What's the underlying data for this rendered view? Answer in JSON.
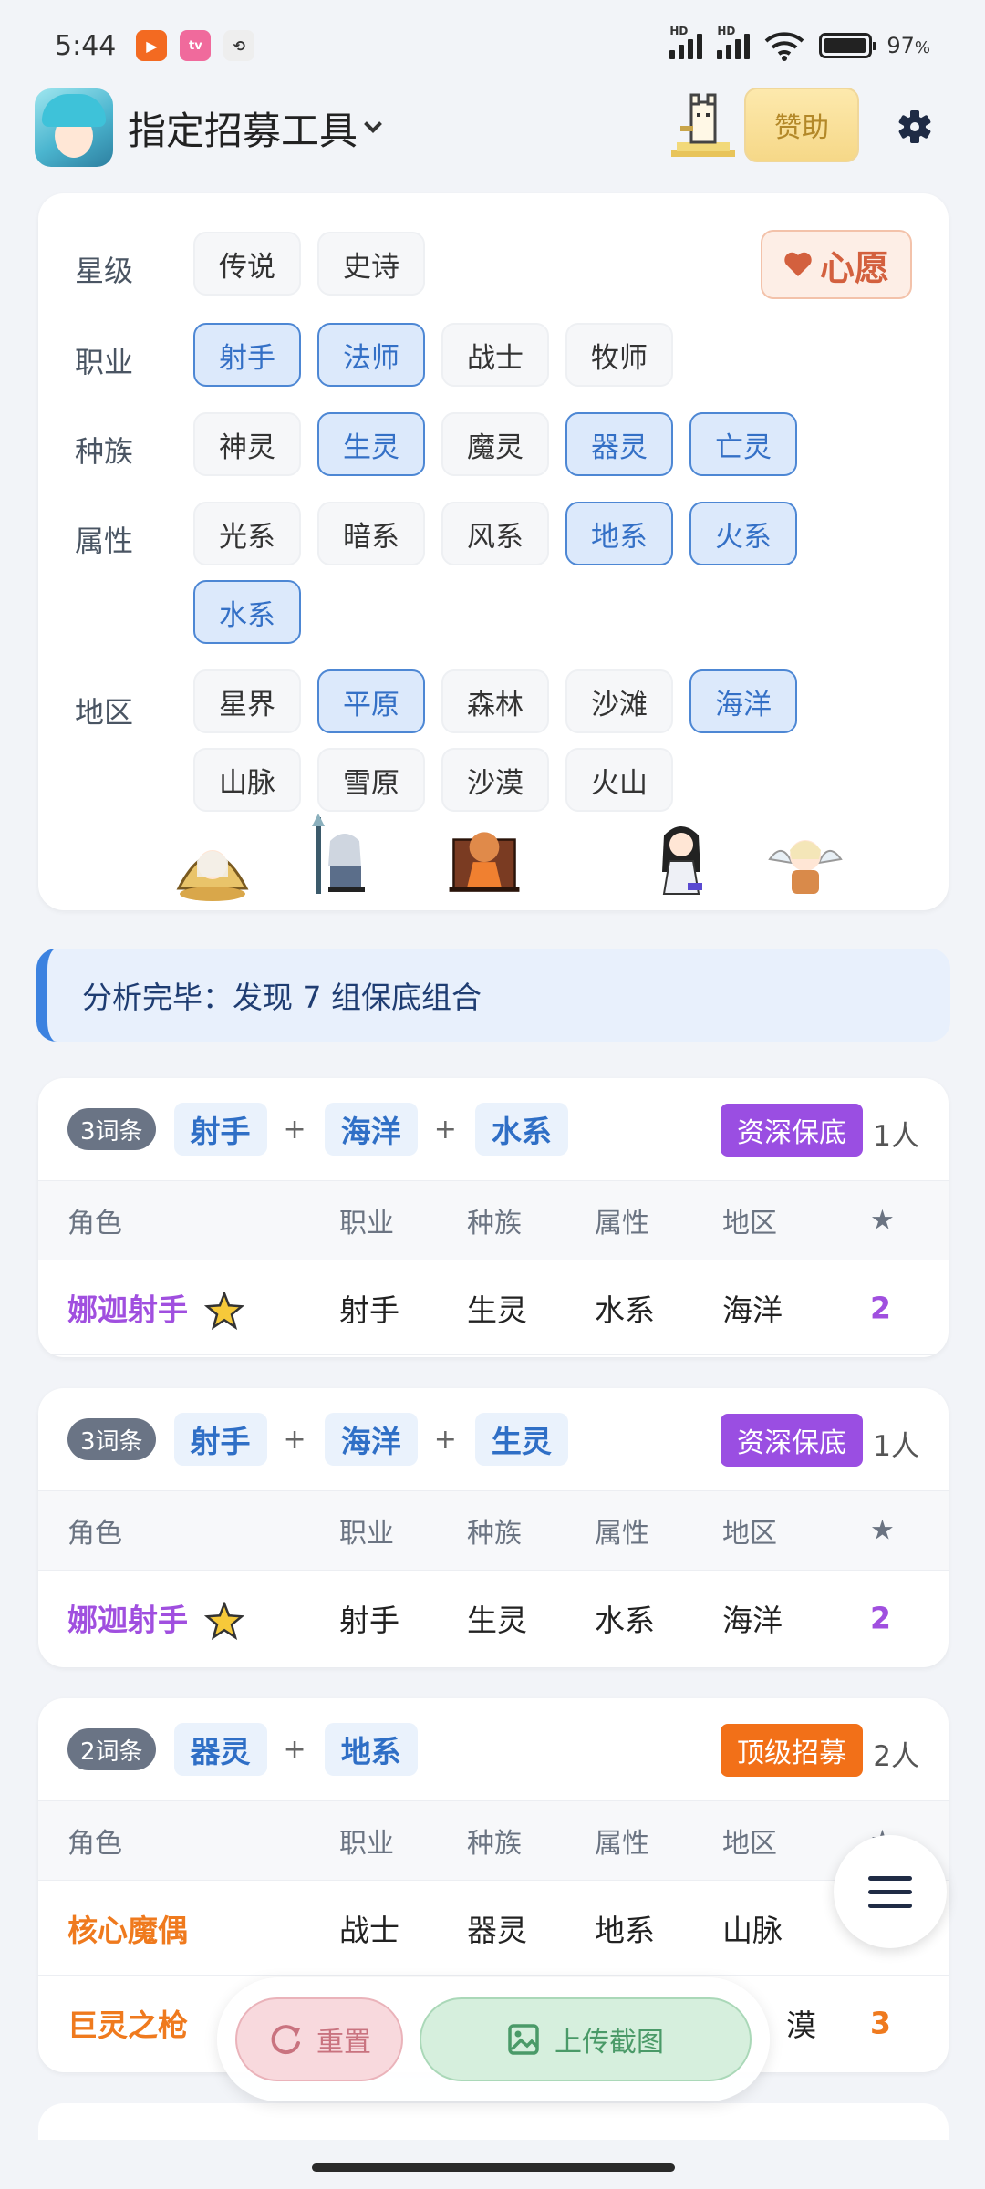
{
  "status_bar": {
    "time": "5:44",
    "battery": "97",
    "battery_level": 0.97,
    "notif_icons": [
      "camera-icon",
      "bilibili-icon",
      "sync-icon"
    ]
  },
  "app_bar": {
    "title": "指定招募工具",
    "sponsor_label": "赞助"
  },
  "filters": {
    "wish_label": "心愿",
    "groups": [
      {
        "label": "星级",
        "options": [
          {
            "text": "传说",
            "selected": false
          },
          {
            "text": "史诗",
            "selected": false
          }
        ]
      },
      {
        "label": "职业",
        "options": [
          {
            "text": "射手",
            "selected": true
          },
          {
            "text": "法师",
            "selected": true
          },
          {
            "text": "战士",
            "selected": false
          },
          {
            "text": "牧师",
            "selected": false
          }
        ]
      },
      {
        "label": "种族",
        "options": [
          {
            "text": "神灵",
            "selected": false
          },
          {
            "text": "生灵",
            "selected": true
          },
          {
            "text": "魔灵",
            "selected": false
          },
          {
            "text": "器灵",
            "selected": true
          },
          {
            "text": "亡灵",
            "selected": true
          }
        ]
      },
      {
        "label": "属性",
        "options": [
          {
            "text": "光系",
            "selected": false
          },
          {
            "text": "暗系",
            "selected": false
          },
          {
            "text": "风系",
            "selected": false
          },
          {
            "text": "地系",
            "selected": true
          },
          {
            "text": "火系",
            "selected": true
          },
          {
            "text": "水系",
            "selected": true
          }
        ]
      },
      {
        "label": "地区",
        "options": [
          {
            "text": "星界",
            "selected": false
          },
          {
            "text": "平原",
            "selected": true
          },
          {
            "text": "森林",
            "selected": false
          },
          {
            "text": "沙滩",
            "selected": false
          },
          {
            "text": "海洋",
            "selected": true
          },
          {
            "text": "山脉",
            "selected": false
          },
          {
            "text": "雪原",
            "selected": false
          },
          {
            "text": "沙漠",
            "selected": false
          },
          {
            "text": "火山",
            "selected": false
          }
        ]
      }
    ]
  },
  "analysis": {
    "text": "分析完毕：发现 7 组保底组合"
  },
  "table_headers": [
    "角色",
    "职业",
    "种族",
    "属性",
    "地区",
    "★"
  ],
  "results": [
    {
      "count_label": "3词条",
      "tags": [
        "射手",
        "海洋",
        "水系"
      ],
      "badge": "资深保底",
      "badge_color": "#9a4ee2",
      "people": "1人",
      "rows": [
        {
          "name": "娜迦射手",
          "job": "射手",
          "race": "生灵",
          "attr": "水系",
          "region": "海洋",
          "stars": "2"
        }
      ]
    },
    {
      "count_label": "3词条",
      "tags": [
        "射手",
        "海洋",
        "生灵"
      ],
      "badge": "资深保底",
      "badge_color": "#9a4ee2",
      "people": "1人",
      "rows": [
        {
          "name": "娜迦射手",
          "job": "射手",
          "race": "生灵",
          "attr": "水系",
          "region": "海洋",
          "stars": "2"
        }
      ]
    },
    {
      "count_label": "2词条",
      "tags": [
        "器灵",
        "地系"
      ],
      "badge": "顶级招募",
      "badge_color": "#f27018",
      "people": "2人",
      "rows": [
        {
          "name": "核心魔偶",
          "job": "战士",
          "race": "器灵",
          "attr": "地系",
          "region": "山脉",
          "stars": ""
        },
        {
          "name": "巨灵之枪",
          "job": "",
          "race": "",
          "attr": "",
          "region": "漠",
          "stars": "3"
        }
      ]
    }
  ],
  "actions": {
    "reset_label": "重置",
    "upload_label": "上传截图"
  }
}
